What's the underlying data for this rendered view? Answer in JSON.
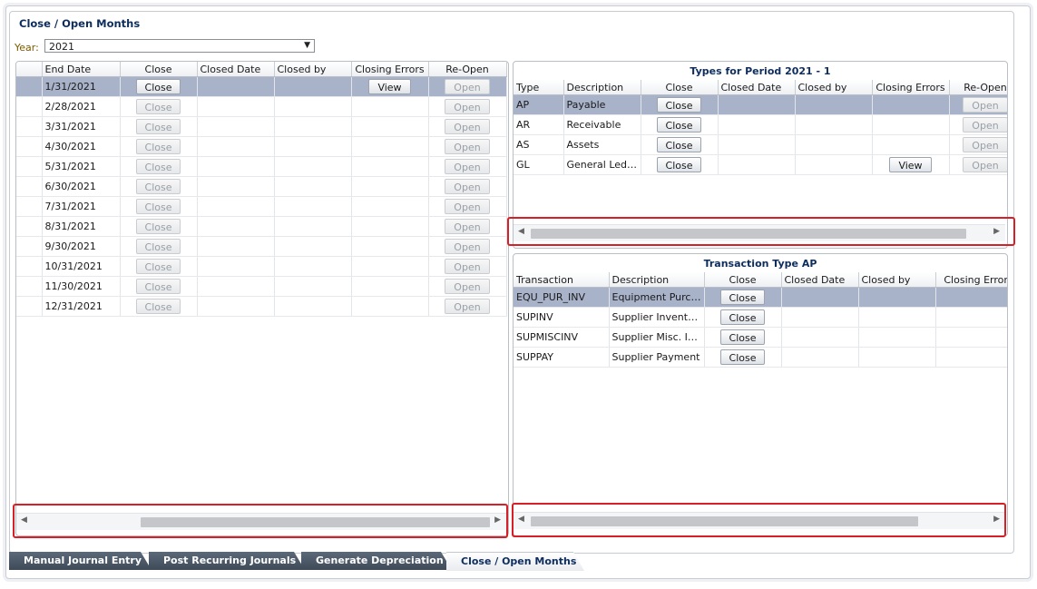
{
  "title": "Close / Open Months",
  "year": {
    "label": "Year:",
    "value": "2021"
  },
  "months_table": {
    "headers": [
      "End Date",
      "Close",
      "Closed Date",
      "Closed by",
      "Closing Errors",
      "Re-Open"
    ],
    "rows": [
      {
        "end_date": "1/31/2021",
        "close": "Close",
        "closing_errors": "View",
        "reopen": "Open"
      },
      {
        "end_date": "2/28/2021",
        "close": "Close",
        "closing_errors": "",
        "reopen": "Open"
      },
      {
        "end_date": "3/31/2021",
        "close": "Close",
        "closing_errors": "",
        "reopen": "Open"
      },
      {
        "end_date": "4/30/2021",
        "close": "Close",
        "closing_errors": "",
        "reopen": "Open"
      },
      {
        "end_date": "5/31/2021",
        "close": "Close",
        "closing_errors": "",
        "reopen": "Open"
      },
      {
        "end_date": "6/30/2021",
        "close": "Close",
        "closing_errors": "",
        "reopen": "Open"
      },
      {
        "end_date": "7/31/2021",
        "close": "Close",
        "closing_errors": "",
        "reopen": "Open"
      },
      {
        "end_date": "8/31/2021",
        "close": "Close",
        "closing_errors": "",
        "reopen": "Open"
      },
      {
        "end_date": "9/30/2021",
        "close": "Close",
        "closing_errors": "",
        "reopen": "Open"
      },
      {
        "end_date": "10/31/2021",
        "close": "Close",
        "closing_errors": "",
        "reopen": "Open"
      },
      {
        "end_date": "11/30/2021",
        "close": "Close",
        "closing_errors": "",
        "reopen": "Open"
      },
      {
        "end_date": "12/31/2021",
        "close": "Close",
        "closing_errors": "",
        "reopen": "Open"
      }
    ]
  },
  "types_panel": {
    "title": "Types for Period 2021 - 1",
    "headers": [
      "Type",
      "Description",
      "Close",
      "Closed Date",
      "Closed by",
      "Closing Errors",
      "Re-Open"
    ],
    "rows": [
      {
        "type": "AP",
        "description": "Payable",
        "close": "Close",
        "closing_errors": "",
        "reopen": "Open"
      },
      {
        "type": "AR",
        "description": "Receivable",
        "close": "Close",
        "closing_errors": "",
        "reopen": "Open"
      },
      {
        "type": "AS",
        "description": "Assets",
        "close": "Close",
        "closing_errors": "",
        "reopen": "Open"
      },
      {
        "type": "GL",
        "description": "General Ledger",
        "close": "Close",
        "closing_errors": "View",
        "reopen": "Open"
      }
    ]
  },
  "transactions_panel": {
    "title": "Transaction Type AP",
    "headers": [
      "Transaction",
      "Description",
      "Close",
      "Closed Date",
      "Closed by",
      "Closing Errors"
    ],
    "rows": [
      {
        "transaction": "EQU_PUR_INV",
        "description": "Equipment Purcha...",
        "close": "Close"
      },
      {
        "transaction": "SUPINV",
        "description": "Supplier Inventory...",
        "close": "Close"
      },
      {
        "transaction": "SUPMISCINV",
        "description": "Supplier Misc. Inv...",
        "close": "Close"
      },
      {
        "transaction": "SUPPAY",
        "description": "Supplier Payment",
        "close": "Close"
      }
    ]
  },
  "tabs": [
    {
      "label": "Manual Journal Entry"
    },
    {
      "label": "Post Recurring Journals"
    },
    {
      "label": "Generate Depreciation"
    },
    {
      "label": "Close / Open Months"
    }
  ],
  "icons": {
    "dropdown": "chevron-down-icon",
    "scroll_left": "scroll-left-icon",
    "scroll_right": "scroll-right-icon"
  },
  "colors": {
    "selected_row": "#a8b2c8",
    "highlight_box": "#d61f26",
    "title": "#0e2d5c"
  }
}
